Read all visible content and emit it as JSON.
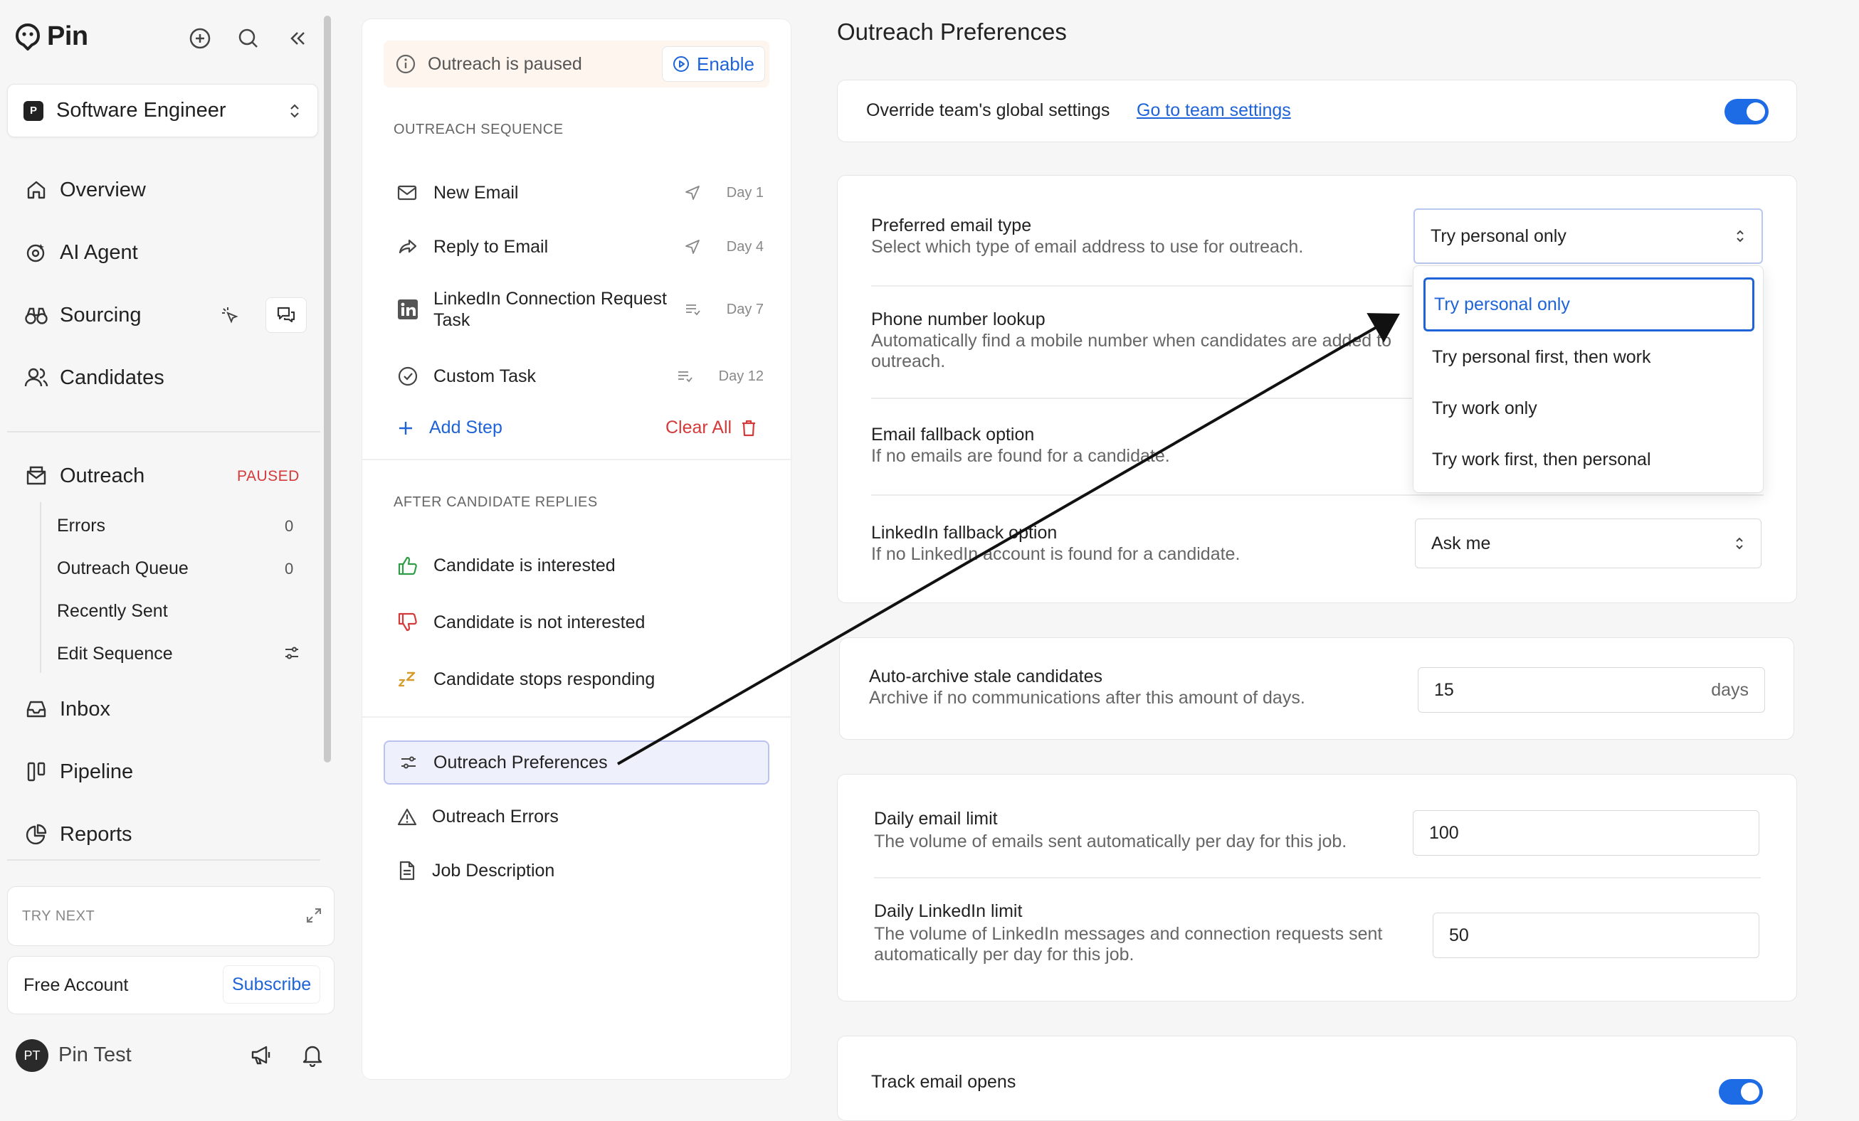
{
  "app": {
    "name": "Pin"
  },
  "sidebar": {
    "job_selector": {
      "badge": "P",
      "label": "Software Engineer"
    },
    "nav": {
      "overview": "Overview",
      "ai_agent": "AI Agent",
      "sourcing": "Sourcing",
      "candidates": "Candidates",
      "outreach": "Outreach",
      "outreach_badge": "PAUSED",
      "inbox": "Inbox",
      "pipeline": "Pipeline",
      "reports": "Reports"
    },
    "outreach_sub": [
      {
        "label": "Errors",
        "count": "0"
      },
      {
        "label": "Outreach Queue",
        "count": "0"
      },
      {
        "label": "Recently Sent",
        "count": ""
      },
      {
        "label": "Edit Sequence",
        "count": ""
      }
    ],
    "try_next": "TRY NEXT",
    "account": {
      "label": "Free Account",
      "subscribe": "Subscribe"
    },
    "user": {
      "initials": "PT",
      "name": "Pin Test"
    }
  },
  "middle": {
    "paused_text": "Outreach is paused",
    "enable_label": "Enable",
    "sequence_title": "OUTREACH SEQUENCE",
    "steps": [
      {
        "label": "New Email",
        "day": "Day 1"
      },
      {
        "label": "Reply to Email",
        "day": "Day 4"
      },
      {
        "label": "LinkedIn Connection Request Task",
        "day": "Day 7"
      },
      {
        "label": "Custom Task",
        "day": "Day 12"
      }
    ],
    "add_step": "Add Step",
    "clear_all": "Clear All",
    "replies_title": "AFTER CANDIDATE REPLIES",
    "replies": [
      "Candidate is interested",
      "Candidate is not interested",
      "Candidate stops responding"
    ],
    "nav": [
      "Outreach Preferences",
      "Outreach Errors",
      "Job Description"
    ]
  },
  "prefs": {
    "title": "Outreach Preferences",
    "override_label": "Override team's global settings",
    "team_link": "Go to team settings",
    "email_type": {
      "label": "Preferred email type",
      "desc": "Select which type of email address to use for outreach.",
      "value": "Try personal only"
    },
    "phone_lookup": {
      "label": "Phone number lookup",
      "desc": "Automatically find a mobile number when candidates are added to outreach."
    },
    "email_fallback": {
      "label": "Email fallback option",
      "desc": "If no emails are found for a candidate."
    },
    "linkedin_fallback": {
      "label": "LinkedIn fallback option",
      "desc": "If no LinkedIn account is found for a candidate.",
      "value": "Ask me"
    },
    "auto_archive": {
      "label": "Auto-archive stale candidates",
      "desc": "Archive if no communications after this amount of days.",
      "value": "15",
      "unit": "days"
    },
    "daily_email": {
      "label": "Daily email limit",
      "desc": "The volume of emails sent automatically per day for this job.",
      "value": "100"
    },
    "daily_linkedin": {
      "label": "Daily LinkedIn limit",
      "desc": "The volume of LinkedIn messages and connection requests sent automatically per day for this job.",
      "value": "50"
    },
    "track_opens": {
      "label": "Track email opens"
    },
    "dropdown_options": [
      "Try personal only",
      "Try personal first, then work",
      "Try work only",
      "Try work first, then personal"
    ]
  },
  "colors": {
    "accent": "#1e64d8",
    "danger": "#d43a3a",
    "paused_bg": "#fdf5ee",
    "green": "#2f9d48"
  }
}
